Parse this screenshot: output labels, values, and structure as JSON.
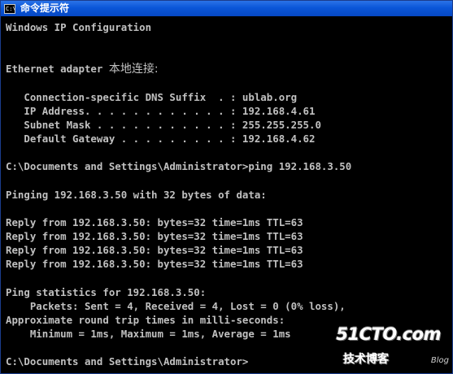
{
  "window": {
    "title": "命令提示符",
    "icon_text": "C:\\"
  },
  "console": {
    "lines": [
      {
        "text": "Windows IP Configuration"
      },
      {
        "text": ""
      },
      {
        "text": ""
      },
      {
        "text": "Ethernet adapter ",
        "cjk": "本地连接:"
      },
      {
        "text": ""
      },
      {
        "text": "   Connection-specific DNS Suffix  . : ublab.org"
      },
      {
        "text": "   IP Address. . . . . . . . . . . . : 192.168.4.61"
      },
      {
        "text": "   Subnet Mask . . . . . . . . . . . : 255.255.255.0"
      },
      {
        "text": "   Default Gateway . . . . . . . . . : 192.168.4.62"
      },
      {
        "text": ""
      },
      {
        "text": "C:\\Documents and Settings\\Administrator>ping 192.168.3.50"
      },
      {
        "text": ""
      },
      {
        "text": "Pinging 192.168.3.50 with 32 bytes of data:"
      },
      {
        "text": ""
      },
      {
        "text": "Reply from 192.168.3.50: bytes=32 time=1ms TTL=63"
      },
      {
        "text": "Reply from 192.168.3.50: bytes=32 time=1ms TTL=63"
      },
      {
        "text": "Reply from 192.168.3.50: bytes=32 time=1ms TTL=63"
      },
      {
        "text": "Reply from 192.168.3.50: bytes=32 time=1ms TTL=63"
      },
      {
        "text": ""
      },
      {
        "text": "Ping statistics for 192.168.3.50:"
      },
      {
        "text": "    Packets: Sent = 4, Received = 4, Lost = 0 (0% loss),"
      },
      {
        "text": "Approximate round trip times in milli-seconds:"
      },
      {
        "text": "    Minimum = 1ms, Maximum = 1ms, Average = 1ms"
      },
      {
        "text": ""
      },
      {
        "text": "C:\\Documents and Settings\\Administrator>"
      }
    ]
  },
  "watermark": {
    "main": "51CTO.com",
    "sub": "技术博客",
    "blog": "Blog"
  },
  "colors": {
    "titlebar": "#0a56d8",
    "console_bg": "#000000",
    "console_fg": "#c0c0c0"
  }
}
